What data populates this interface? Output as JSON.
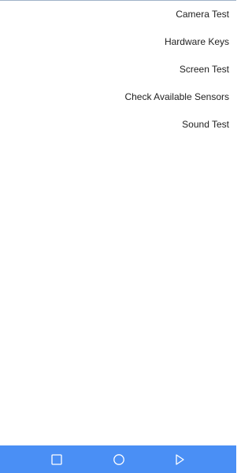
{
  "menu": {
    "items": [
      {
        "label": "Camera Test"
      },
      {
        "label": "Hardware Keys"
      },
      {
        "label": "Screen Test"
      },
      {
        "label": "Check Available Sensors"
      },
      {
        "label": "Sound Test"
      }
    ]
  },
  "navigation_bar": {
    "color": "#4a8ff5",
    "buttons": [
      {
        "icon": "square-icon"
      },
      {
        "icon": "circle-icon"
      },
      {
        "icon": "triangle-icon"
      }
    ]
  }
}
